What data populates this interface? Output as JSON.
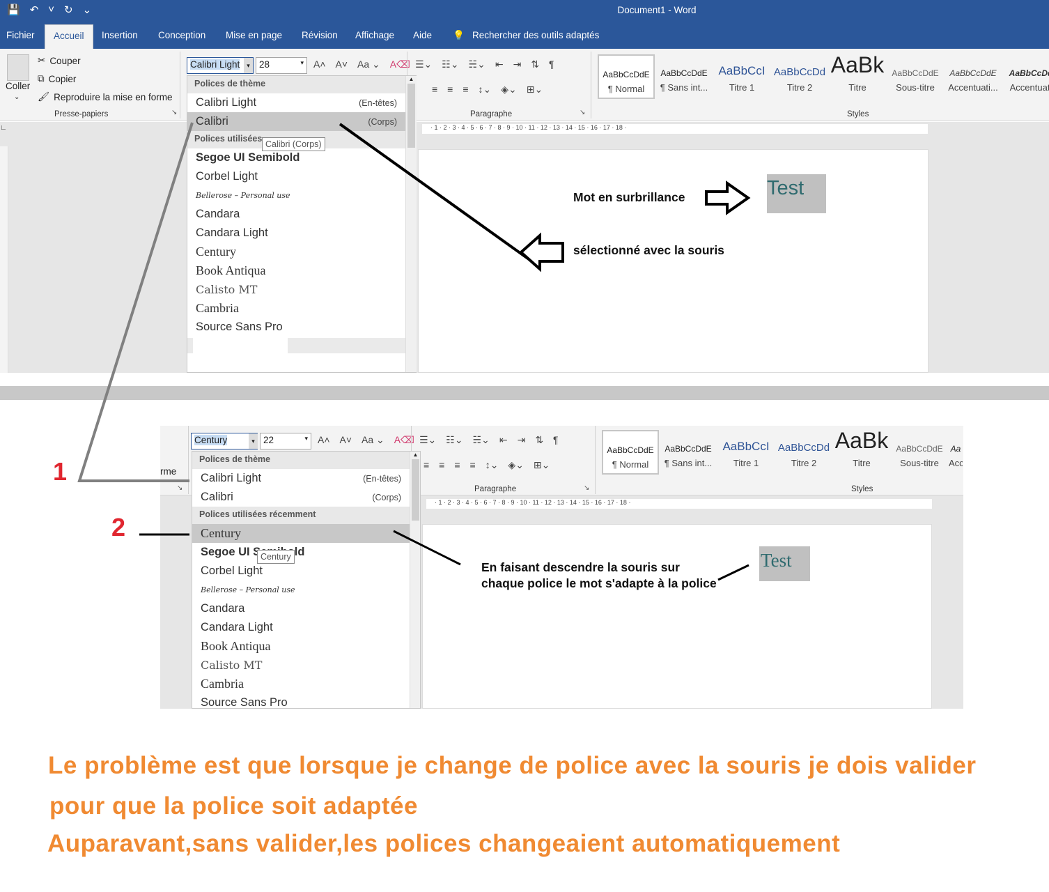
{
  "window": {
    "title": "Document1  -  Word",
    "qat": [
      "💾",
      "↶",
      "˅",
      "↻",
      "⌄"
    ]
  },
  "tabs": [
    "Fichier",
    "Accueil",
    "Insertion",
    "Conception",
    "Mise en page",
    "Révision",
    "Affichage",
    "Aide"
  ],
  "search": "Rechercher des outils adaptés",
  "clipboard": {
    "paste": "Coller",
    "cut": "Couper",
    "copy": "Copier",
    "format": "Reproduire la mise en forme",
    "group": "Presse-papiers",
    "partial": "rme"
  },
  "groups": {
    "paragraph": "Paragraphe",
    "styles": "Styles"
  },
  "styles": [
    {
      "preview": "AaBbCcDdE",
      "name": "¶ Normal"
    },
    {
      "preview": "AaBbCcDdE",
      "name": "¶ Sans int..."
    },
    {
      "preview": "AaBbCcI",
      "name": "Titre 1"
    },
    {
      "preview": "AaBbCcDd",
      "name": "Titre 2"
    },
    {
      "preview": "AaBk",
      "name": "Titre"
    },
    {
      "preview": "AaBbCcDdE",
      "name": "Sous-titre"
    },
    {
      "preview": "AaBbCcDdE",
      "name": "Accentuati..."
    },
    {
      "preview": "AaBbCcDd",
      "name": "Accentuati"
    }
  ],
  "top": {
    "font": "Calibri Light",
    "size": "28",
    "dropdown": {
      "theme_header": "Polices de thème",
      "theme_items": [
        {
          "name": "Calibri Light",
          "tag": "(En-têtes)"
        },
        {
          "name": "Calibri",
          "tag": "(Corps)"
        }
      ],
      "recent_header": "Polices utilisées",
      "tooltip": "Calibri (Corps)",
      "items": [
        "Segoe UI Semibold",
        "Corbel Light",
        "Bellerose – Personal use",
        "Candara",
        "Candara Light",
        "Century",
        "Book Antiqua",
        "Calisto MT",
        "Cambria",
        "Source Sans Pro"
      ]
    },
    "annotation1": "Mot en surbrillance",
    "annotation2": "sélectionné avec la souris",
    "word": "Test"
  },
  "bottom": {
    "font": "Century",
    "size": "22",
    "dropdown": {
      "theme_header": "Polices de thème",
      "theme_items": [
        {
          "name": "Calibri Light",
          "tag": "(En-têtes)"
        },
        {
          "name": "Calibri",
          "tag": "(Corps)"
        }
      ],
      "recent_header": "Polices utilisées récemment",
      "tooltip": "Century",
      "items": [
        "Century",
        "Segoe UI Semibold",
        "Corbel Light",
        "Bellerose – Personal use",
        "Candara",
        "Candara Light",
        "Book Antiqua",
        "Calisto MT",
        "Cambria",
        "Source Sans Pro"
      ]
    },
    "styles_visible": [
      {
        "preview": "AaBbCcDdE",
        "name": "¶ Normal"
      },
      {
        "preview": "AaBbCcDdE",
        "name": "¶ Sans int..."
      },
      {
        "preview": "AaBbCcI",
        "name": "Titre 1"
      },
      {
        "preview": "AaBbCcDd",
        "name": "Titre 2"
      },
      {
        "preview": "AaBk",
        "name": "Titre"
      },
      {
        "preview": "AaBbCcDdE",
        "name": "Sous-titre"
      },
      {
        "preview": "Aa",
        "name": "Acc"
      }
    ],
    "annotation": "En faisant descendre la souris sur chaque police le mot s'adapte à la police",
    "word": "Test",
    "num1": "1",
    "num2": "2"
  },
  "note": {
    "line1": "Le problème est que lorsque je change de police avec la souris je dois valider",
    "line2": "pour que la police soit  adaptée",
    "line3": "Auparavant,sans valider,les polices changeaient automatiquement"
  },
  "ruler_marks": "· 1 · 2 · 3 · 4 · 5 · 6 · 7 · 8 · 9 · 10 · 11 · 12 · 13 · 14 · 15 · 16 · 17 · 18 ·",
  "colors": {
    "word_blue": "#2b579a",
    "orange": "#f08a32",
    "red": "#e0262f",
    "highlight": "#c0c0c0",
    "teal": "#2f6b6f"
  }
}
